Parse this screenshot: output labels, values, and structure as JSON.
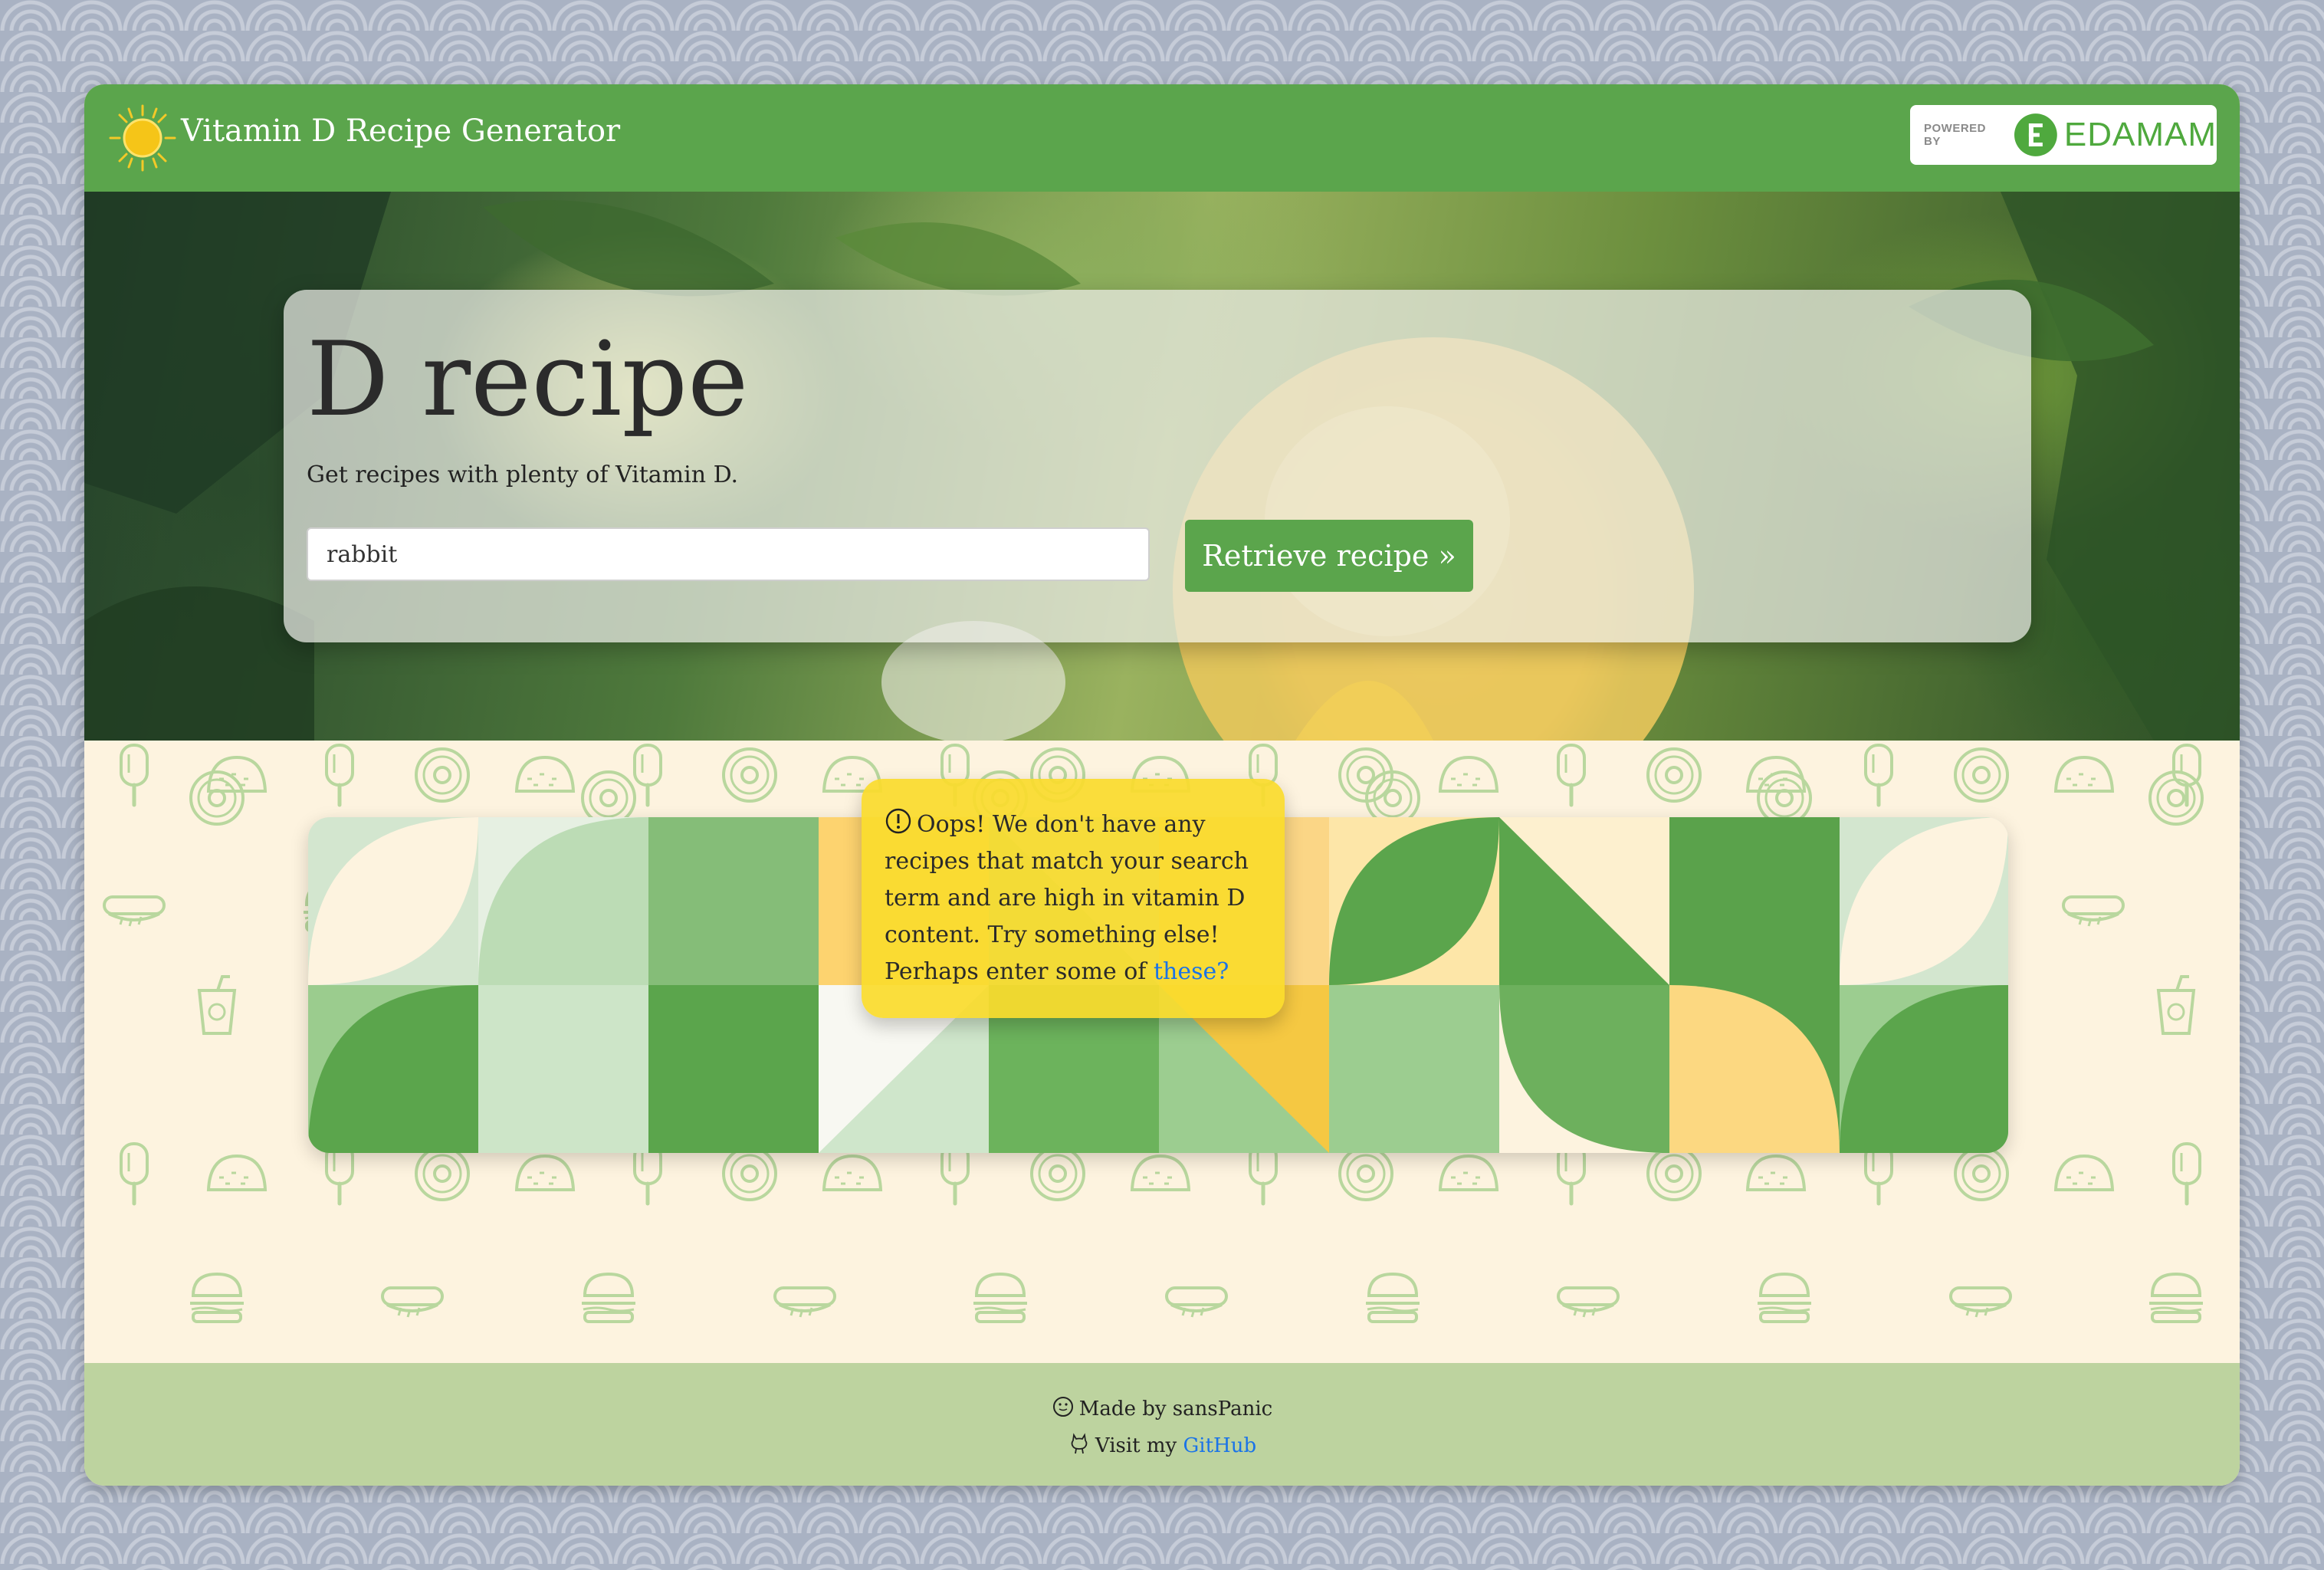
{
  "header": {
    "title": "Vitamin D Recipe Generator",
    "badge_powered": "POWERED BY",
    "badge_brand": "EDAMAM"
  },
  "hero": {
    "title": "D recipe",
    "subtitle": "Get recipes with plenty of Vitamin D.",
    "search_value": "rabbit",
    "button_label": "Retrieve recipe »"
  },
  "alert": {
    "message": "Oops! We don't have any recipes that match your search term and are high in vitamin D content. Try something else! Perhaps enter some of ",
    "link_text": "these?"
  },
  "footer": {
    "made_by": "Made by sansPanic",
    "visit_prefix": "Visit my ",
    "github_link": "GitHub"
  },
  "colors": {
    "brand_green": "#5ba54c",
    "alert_yellow": "#fadb2d",
    "footer_green": "#bdd39f",
    "link_blue": "#1a73e8"
  },
  "icons": [
    "sun-icon",
    "edamam-logo-icon",
    "alert-circle-icon",
    "smile-icon",
    "github-icon"
  ]
}
